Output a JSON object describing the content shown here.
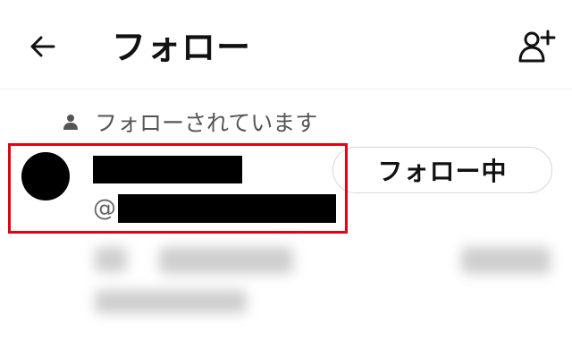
{
  "header": {
    "title": "フォロー",
    "back_icon": "arrow-left-icon",
    "add_user_icon": "add-user-icon"
  },
  "followed_by": {
    "icon": "person-icon",
    "text": "フォローされています"
  },
  "user": {
    "handle_prefix": "@",
    "follow_button_label": "フォロー中"
  },
  "colors": {
    "highlight": "#e60012",
    "text_primary": "#111111",
    "text_secondary": "#555555",
    "button_border": "#cfd9de"
  }
}
